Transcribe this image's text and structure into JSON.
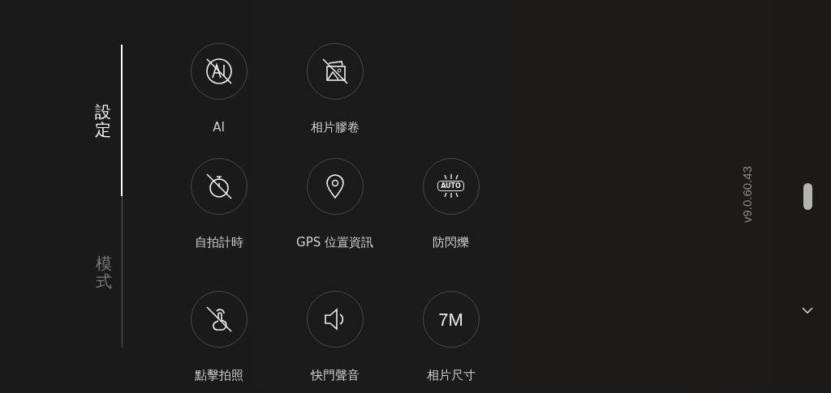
{
  "tabs": [
    {
      "label": "設定",
      "selected": true
    },
    {
      "label": "模式",
      "selected": false
    }
  ],
  "settings": [
    [
      {
        "kind": "icon",
        "label": "AI",
        "on": false
      },
      {
        "kind": "icon",
        "label": "相片膠卷",
        "on": false
      }
    ],
    [
      {
        "kind": "icon",
        "label": "自拍計時",
        "on": false
      },
      {
        "kind": "icon",
        "label": "GPS 位置資訊",
        "on": true
      },
      {
        "kind": "badge",
        "label": "防閃爍",
        "value": "AUTO"
      }
    ],
    [
      {
        "kind": "icon",
        "label": "點擊拍照",
        "on": false
      },
      {
        "kind": "icon",
        "label": "快門聲音",
        "on": true
      },
      {
        "kind": "text",
        "label": "相片尺寸",
        "value": "7M"
      }
    ]
  ],
  "version": "v9.0.60.43"
}
